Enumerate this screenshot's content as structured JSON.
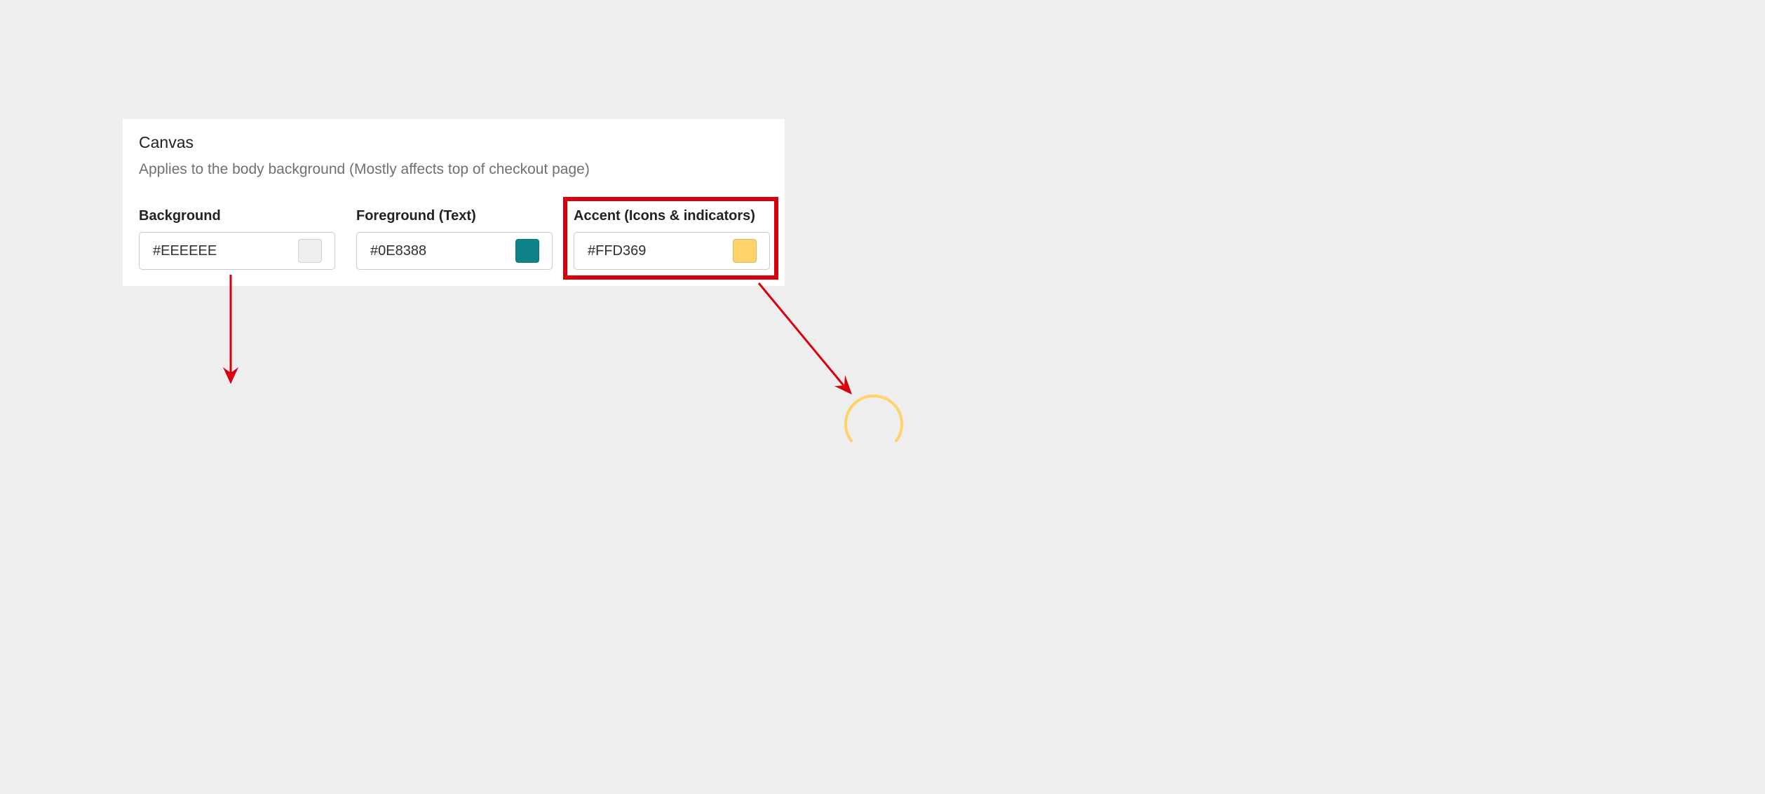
{
  "section": {
    "title": "Canvas",
    "description": "Applies to the body background (Mostly affects top of checkout page)"
  },
  "fields": [
    {
      "label": "Background",
      "value": "#EEEEEE",
      "swatch_color": "#EEEEEE"
    },
    {
      "label": "Foreground (Text)",
      "value": "#0E8388",
      "swatch_color": "#0E8388"
    },
    {
      "label": "Accent (Icons & indicators)",
      "value": "#FFD369",
      "swatch_color": "#FFD369"
    }
  ],
  "colors": {
    "page_background": "#EEEEEE",
    "card_background": "#FFFFFF",
    "annotation_red": "#D9000D",
    "spinner_accent": "#FFD369"
  },
  "icons": {
    "annotation_arrow": "arrow-icon",
    "spinner": "spinner-icon"
  }
}
